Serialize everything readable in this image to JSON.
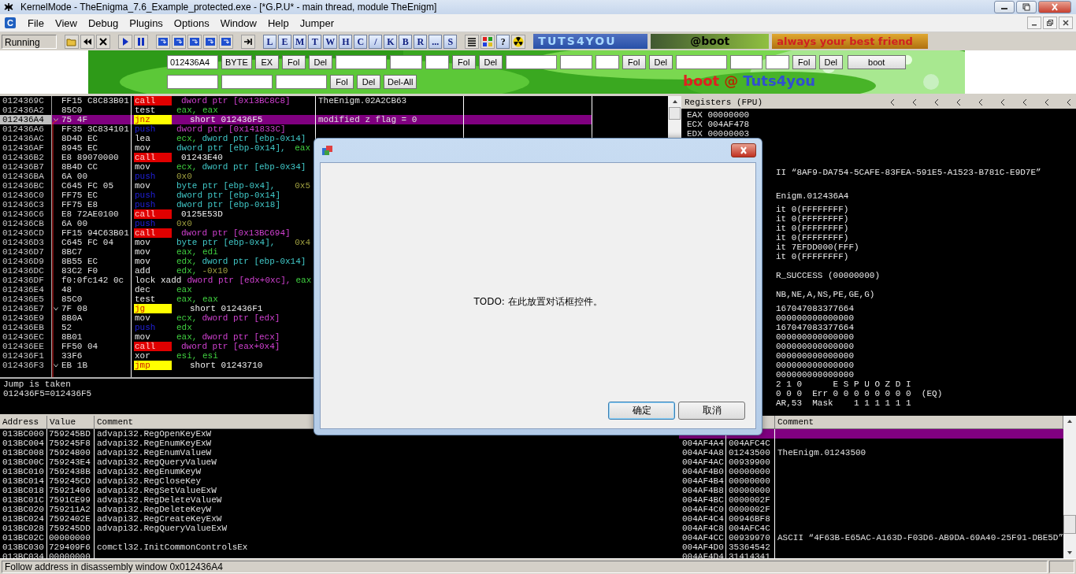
{
  "window": {
    "title": "KernelMode - TheEnigma_7.6_Example_protected.exe - [*G.P.U* - main thread, module TheEnigm]"
  },
  "menu": {
    "app_letter": "C",
    "items": [
      "File",
      "View",
      "Debug",
      "Plugins",
      "Options",
      "Window",
      "Help",
      "Jumper"
    ]
  },
  "toolbar": {
    "status": "Running",
    "letter_buttons": [
      "L",
      "E",
      "M",
      "T",
      "W",
      "H",
      "C",
      "/",
      "K",
      "B",
      "R",
      "...",
      "S"
    ],
    "help_button": "?",
    "banners": [
      "TUTS4YOU",
      "@boot",
      "always your best friend"
    ]
  },
  "banner": {
    "rows": [
      [
        {
          "kind": "wide_field",
          "value": "012436A4"
        },
        {
          "kind": "button",
          "label": "BYTE"
        },
        {
          "kind": "button",
          "label": "EX"
        },
        {
          "kind": "button",
          "label": "Fol"
        },
        {
          "kind": "button",
          "label": "Del"
        },
        {
          "kind": "wide_field"
        },
        {
          "kind": "mid_field"
        },
        {
          "kind": "narrow_field"
        },
        {
          "kind": "button",
          "label": "Fol"
        },
        {
          "kind": "button",
          "label": "Del"
        },
        {
          "kind": "wide_field"
        },
        {
          "kind": "mid_field"
        },
        {
          "kind": "narrow_field"
        },
        {
          "kind": "button",
          "label": "Fol"
        },
        {
          "kind": "button",
          "label": "Del"
        },
        {
          "kind": "wide_field"
        },
        {
          "kind": "mid_field"
        },
        {
          "kind": "narrow_field"
        },
        {
          "kind": "button",
          "label": "Fol"
        },
        {
          "kind": "button",
          "label": "Del"
        },
        {
          "kind": "wide_button",
          "label": "boot"
        }
      ],
      [
        {
          "kind": "wide_field"
        },
        {
          "kind": "wide_field"
        },
        {
          "kind": "wide_field"
        },
        {
          "kind": "button",
          "label": "Fol"
        },
        {
          "kind": "button",
          "label": "Del"
        },
        {
          "kind": "button",
          "label": "Del-All"
        }
      ]
    ],
    "signature": [
      "boot",
      "@",
      "Tuts4you"
    ]
  },
  "disassembly": {
    "rows": [
      {
        "address": "0124369C",
        "bytes": "FF15 C8C83B01",
        "mnemonic": "call",
        "kind": "call",
        "operands": [
          {
            "kind": "ptr",
            "t": "dword ptr [0x13BC8C8]"
          }
        ],
        "comment": "TheEnigm.02A2CB63",
        "selected": false,
        "jump": false
      },
      {
        "address": "012436A2",
        "bytes": "85C0",
        "mnemonic": "test",
        "kind": "plain",
        "operands": [
          {
            "kind": "reg",
            "t": "eax, eax"
          }
        ],
        "selected": false,
        "jump": false
      },
      {
        "address": "012436A4",
        "bytes": "75 4F",
        "mnemonic": "jnz",
        "kind": "jump",
        "operands": [
          {
            "kind": "target",
            "t": "short 012436F5"
          }
        ],
        "comment": "modified z flag = 0",
        "selected": true,
        "jump": true
      },
      {
        "address": "012436A6",
        "bytes": "FF35 3C834101",
        "mnemonic": "push",
        "kind": "push",
        "operands": [
          {
            "kind": "ptr",
            "t": "dword ptr [0x141833C]"
          }
        ],
        "selected": false,
        "jump": false
      },
      {
        "address": "012436AC",
        "bytes": "8D4D EC",
        "mnemonic": "lea",
        "kind": "plain",
        "operands": [
          {
            "kind": "reg",
            "t": "ecx,"
          },
          {
            "kind": "stack",
            "t": "dword ptr [ebp-0x14]"
          }
        ],
        "selected": false,
        "jump": false
      },
      {
        "address": "012436AF",
        "bytes": "8945 EC",
        "mnemonic": "mov",
        "kind": "plain",
        "operands": [
          {
            "kind": "stack",
            "t": "dword ptr [ebp-0x14],"
          },
          {
            "kind": "reg",
            "t": "eax"
          }
        ],
        "selected": false,
        "jump": false
      },
      {
        "address": "012436B2",
        "bytes": "E8 89070000",
        "mnemonic": "call",
        "kind": "call",
        "operands": [
          {
            "kind": "target",
            "t": "01243E40"
          }
        ],
        "selected": false,
        "jump": false
      },
      {
        "address": "012436B7",
        "bytes": "8B4D CC",
        "mnemonic": "mov",
        "kind": "plain",
        "operands": [
          {
            "kind": "reg",
            "t": "ecx,"
          },
          {
            "kind": "stack",
            "t": "dword ptr [ebp-0x34]"
          }
        ],
        "selected": false,
        "jump": false
      },
      {
        "address": "012436BA",
        "bytes": "6A 00",
        "mnemonic": "push",
        "kind": "push",
        "operands": [
          {
            "kind": "imm",
            "t": "0x0"
          }
        ],
        "selected": false,
        "jump": false
      },
      {
        "address": "012436BC",
        "bytes": "C645 FC 05",
        "mnemonic": "mov",
        "kind": "plain",
        "operands": [
          {
            "kind": "stack",
            "t": "byte ptr [ebp-0x4],"
          },
          {
            "kind": "imm",
            "t": "0x5"
          }
        ],
        "selected": false,
        "jump": false
      },
      {
        "address": "012436C0",
        "bytes": "FF75 EC",
        "mnemonic": "push",
        "kind": "push",
        "operands": [
          {
            "kind": "stack",
            "t": "dword ptr [ebp-0x14]"
          }
        ],
        "selected": false,
        "jump": false
      },
      {
        "address": "012436C3",
        "bytes": "FF75 E8",
        "mnemonic": "push",
        "kind": "push",
        "operands": [
          {
            "kind": "stack",
            "t": "dword ptr [ebp-0x18]"
          }
        ],
        "selected": false,
        "jump": false
      },
      {
        "address": "012436C6",
        "bytes": "E8 72AE0100",
        "mnemonic": "call",
        "kind": "call",
        "operands": [
          {
            "kind": "target",
            "t": "0125E53D"
          }
        ],
        "selected": false,
        "jump": false
      },
      {
        "address": "012436CB",
        "bytes": "6A 00",
        "mnemonic": "push",
        "kind": "push",
        "operands": [
          {
            "kind": "imm",
            "t": "0x0"
          }
        ],
        "selected": false,
        "jump": false
      },
      {
        "address": "012436CD",
        "bytes": "FF15 94C63B01",
        "mnemonic": "call",
        "kind": "call",
        "operands": [
          {
            "kind": "ptr",
            "t": "dword ptr [0x13BC694]"
          }
        ],
        "selected": false,
        "jump": false
      },
      {
        "address": "012436D3",
        "bytes": "C645 FC 04",
        "mnemonic": "mov",
        "kind": "plain",
        "operands": [
          {
            "kind": "stack",
            "t": "byte ptr [ebp-0x4],"
          },
          {
            "kind": "imm",
            "t": "0x4"
          }
        ],
        "selected": false,
        "jump": false
      },
      {
        "address": "012436D7",
        "bytes": "8BC7",
        "mnemonic": "mov",
        "kind": "plain",
        "operands": [
          {
            "kind": "reg",
            "t": "eax, edi"
          }
        ],
        "selected": false,
        "jump": false
      },
      {
        "address": "012436D9",
        "bytes": "8B55 EC",
        "mnemonic": "mov",
        "kind": "plain",
        "operands": [
          {
            "kind": "reg",
            "t": "edx,"
          },
          {
            "kind": "stack",
            "t": "dword ptr [ebp-0x14]"
          }
        ],
        "selected": false,
        "jump": false
      },
      {
        "address": "012436DC",
        "bytes": "83C2 F0",
        "mnemonic": "add",
        "kind": "plain",
        "operands": [
          {
            "kind": "reg",
            "t": "edx,"
          },
          {
            "kind": "imm",
            "t": "-0x10"
          }
        ],
        "selected": false,
        "jump": false
      },
      {
        "address": "012436DF",
        "bytes": "f0:0fc142 0c",
        "mnemonic": "lock xadd",
        "kind": "plain",
        "operands": [
          {
            "kind": "ptr",
            "t": "dword ptr [edx+0xc],"
          },
          {
            "kind": "reg",
            "t": "eax"
          }
        ],
        "selected": false,
        "jump": false
      },
      {
        "address": "012436E4",
        "bytes": "48",
        "mnemonic": "dec",
        "kind": "plain",
        "operands": [
          {
            "kind": "reg",
            "t": "eax"
          }
        ],
        "selected": false,
        "jump": false
      },
      {
        "address": "012436E5",
        "bytes": "85C0",
        "mnemonic": "test",
        "kind": "plain",
        "operands": [
          {
            "kind": "reg",
            "t": "eax, eax"
          }
        ],
        "selected": false,
        "jump": false
      },
      {
        "address": "012436E7",
        "bytes": "7F 08",
        "mnemonic": "jg",
        "kind": "jump",
        "operands": [
          {
            "kind": "target",
            "t": "short 012436F1"
          }
        ],
        "selected": false,
        "jump": true
      },
      {
        "address": "012436E9",
        "bytes": "8B0A",
        "mnemonic": "mov",
        "kind": "plain",
        "operands": [
          {
            "kind": "reg",
            "t": "ecx,"
          },
          {
            "kind": "ptr",
            "t": "dword ptr [edx]"
          }
        ],
        "selected": false,
        "jump": false
      },
      {
        "address": "012436EB",
        "bytes": "52",
        "mnemonic": "push",
        "kind": "push",
        "operands": [
          {
            "kind": "reg",
            "t": "edx"
          }
        ],
        "selected": false,
        "jump": false
      },
      {
        "address": "012436EC",
        "bytes": "8B01",
        "mnemonic": "mov",
        "kind": "plain",
        "operands": [
          {
            "kind": "reg",
            "t": "eax,"
          },
          {
            "kind": "ptr",
            "t": "dword ptr [ecx]"
          }
        ],
        "selected": false,
        "jump": false
      },
      {
        "address": "012436EE",
        "bytes": "FF50 04",
        "mnemonic": "call",
        "kind": "call",
        "operands": [
          {
            "kind": "ptr",
            "t": "dword ptr [eax+0x4]"
          }
        ],
        "selected": false,
        "jump": false
      },
      {
        "address": "012436F1",
        "bytes": "33F6",
        "mnemonic": "xor",
        "kind": "plain",
        "operands": [
          {
            "kind": "reg",
            "t": "esi, esi"
          }
        ],
        "selected": false,
        "jump": false
      },
      {
        "address": "012436F3",
        "bytes": "EB 1B",
        "mnemonic": "jmp",
        "kind": "jump",
        "operands": [
          {
            "kind": "target",
            "t": "short 01243710"
          }
        ],
        "selected": false,
        "jump": true
      }
    ],
    "info": [
      "Jump is taken",
      "012436F5=012436F5"
    ]
  },
  "registers": {
    "title": "Registers (FPU)",
    "groups": [
      {
        "kind": "full",
        "lines": [
          "EAX 00000000",
          "ECX 004AF478",
          "EDX 00000003"
        ]
      },
      {
        "kind": "clipped",
        "lines": [
          "II “8AF9-DA754-5CAFE-83FEA-591E5-A1523-B781C-E9D7E”"
        ]
      },
      {
        "kind": "clipped",
        "lines": [
          "Enigm.012436A4"
        ]
      },
      {
        "kind": "clipped",
        "lines": [
          "it 0(FFFFFFFF)",
          "it 0(FFFFFFFF)",
          "it 0(FFFFFFFF)",
          "it 0(FFFFFFFF)",
          "it 7EFDD000(FFF)",
          "it 0(FFFFFFFF)"
        ]
      },
      {
        "kind": "clipped",
        "lines": [
          "R_SUCCESS (00000000)"
        ]
      },
      {
        "kind": "clipped",
        "lines": [
          "NB,NE,A,NS,PE,GE,G)"
        ]
      },
      {
        "kind": "clipped",
        "lines": [
          "167047083377664",
          "000000000000000",
          "167047083377664",
          "000000000000000",
          "000000000000000",
          "000000000000000",
          "000000000000000",
          "000000000000000",
          "2 1 0      E S P U O Z D I",
          "0 0 0  Err 0 0 0 0 0 0 0 0  (EQ)",
          "AR,53  Mask    1 1 1 1 1 1"
        ]
      }
    ]
  },
  "dump": {
    "columns": [
      "Address",
      "Value",
      "Comment"
    ],
    "rows": [
      {
        "address": "013BC000",
        "value": "759245BD",
        "comment": "advapi32.RegOpenKeyExW"
      },
      {
        "address": "013BC004",
        "value": "759245F8",
        "comment": "advapi32.RegEnumKeyExW"
      },
      {
        "address": "013BC008",
        "value": "75924800",
        "comment": "advapi32.RegEnumValueW"
      },
      {
        "address": "013BC00C",
        "value": "759243E4",
        "comment": "advapi32.RegQueryValueW"
      },
      {
        "address": "013BC010",
        "value": "7592438B",
        "comment": "advapi32.RegEnumKeyW"
      },
      {
        "address": "013BC014",
        "value": "759245CD",
        "comment": "advapi32.RegCloseKey"
      },
      {
        "address": "013BC018",
        "value": "75921406",
        "comment": "advapi32.RegSetValueExW"
      },
      {
        "address": "013BC01C",
        "value": "7591CE99",
        "comment": "advapi32.RegDeleteValueW"
      },
      {
        "address": "013BC020",
        "value": "759211A2",
        "comment": "advapi32.RegDeleteKeyW"
      },
      {
        "address": "013BC024",
        "value": "7592402E",
        "comment": "advapi32.RegCreateKeyExW"
      },
      {
        "address": "013BC028",
        "value": "759245DD",
        "comment": "advapi32.RegQueryValueExW"
      },
      {
        "address": "013BC02C",
        "value": "00000000"
      },
      {
        "address": "013BC030",
        "value": "729409F6",
        "comment": "comctl32.InitCommonControlsEx"
      },
      {
        "address": "013BC034",
        "value": "00000000"
      }
    ]
  },
  "stack": {
    "columns": [
      "Comment"
    ],
    "rows": [
      {
        "selected": true
      },
      {
        "address": "004AF4A4",
        "value": "004AFC4C",
        "selected": false
      },
      {
        "address": "004AF4A8",
        "value": "01243500",
        "comment": "TheEnigm.01243500",
        "selected": false
      },
      {
        "address": "004AF4AC",
        "value": "00939900",
        "selected": false
      },
      {
        "address": "004AF4B0",
        "value": "00000000",
        "selected": false
      },
      {
        "address": "004AF4B4",
        "value": "00000000",
        "selected": false
      },
      {
        "address": "004AF4B8",
        "value": "00000000",
        "selected": false
      },
      {
        "address": "004AF4BC",
        "value": "0000002F",
        "selected": false
      },
      {
        "address": "004AF4C0",
        "value": "0000002F",
        "selected": false
      },
      {
        "address": "004AF4C4",
        "value": "00946BF8",
        "selected": false
      },
      {
        "address": "004AF4C8",
        "value": "004AFC4C",
        "selected": false
      },
      {
        "address": "004AF4CC",
        "value": "00939970",
        "comment": "ASCII “4F63B-E65AC-A163D-F03D6-AB9DA-69A40-25F91-DBE5D”",
        "selected": false
      },
      {
        "address": "004AF4D0",
        "value": "35364542",
        "selected": false
      },
      {
        "address": "004AF4D4",
        "value": "31414341",
        "selected": false
      }
    ]
  },
  "dialog": {
    "message": "TODO: 在此放置对话框控件。",
    "buttons": [
      {
        "label": "确定",
        "selected": true
      },
      {
        "label": "取消",
        "selected": false
      }
    ]
  },
  "status_bar": {
    "text": "Follow address in disassembly window 0x012436A4"
  }
}
